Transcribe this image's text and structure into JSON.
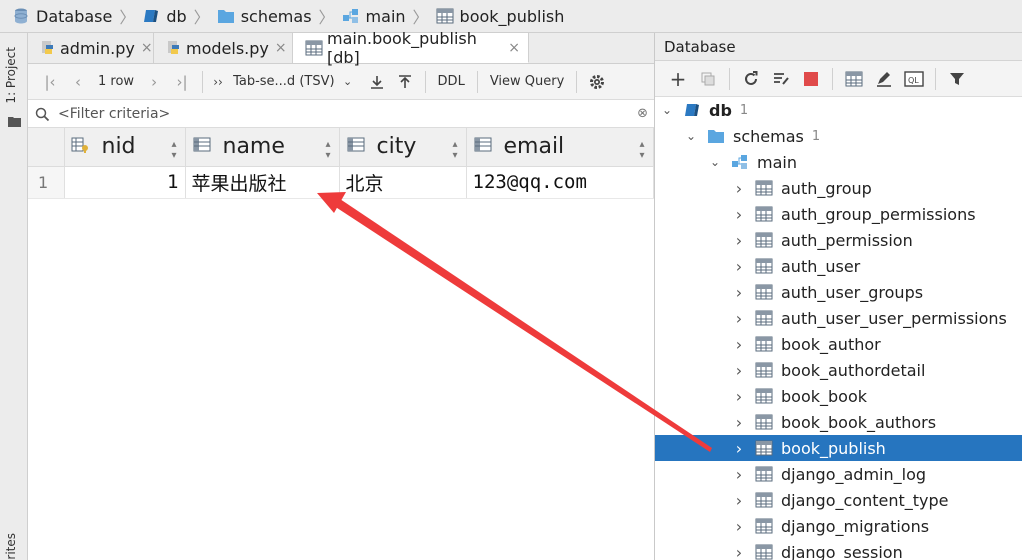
{
  "breadcrumb": {
    "items": [
      "Database",
      "db",
      "schemas",
      "main",
      "book_publish"
    ]
  },
  "left_strip": {
    "project_label": "1: Project",
    "favorites_label": "rites"
  },
  "editor": {
    "tabs": [
      {
        "label": "admin.py",
        "close": "×"
      },
      {
        "label": "models.py",
        "close": "×"
      },
      {
        "label": "main.book_publish [db]",
        "close": "×",
        "active": true
      }
    ],
    "toolbar": {
      "row_count": "1 row",
      "format": "Tab-se...d (TSV)",
      "ddl": "DDL",
      "view_query": "View Query"
    },
    "filter": {
      "placeholder": "<Filter criteria>",
      "clear": "⊗"
    },
    "grid": {
      "columns": [
        "nid",
        "name",
        "city",
        "email"
      ],
      "rows": [
        {
          "num": "1",
          "nid": "1",
          "name": "苹果出版社",
          "city": "北京",
          "email": "123@qq.com"
        }
      ]
    }
  },
  "db_panel": {
    "title": "Database",
    "tree": {
      "db": {
        "label": "db",
        "count": "1"
      },
      "schemas": {
        "label": "schemas",
        "count": "1"
      },
      "main": {
        "label": "main"
      },
      "tables": [
        "auth_group",
        "auth_group_permissions",
        "auth_permission",
        "auth_user",
        "auth_user_groups",
        "auth_user_user_permissions",
        "book_author",
        "book_authordetail",
        "book_book",
        "book_book_authors",
        "book_publish",
        "django_admin_log",
        "django_content_type",
        "django_migrations",
        "django_session"
      ],
      "selected": "book_publish"
    }
  },
  "colors": {
    "selection": "#2675bf",
    "arrow": "#ee3b3b",
    "table_icon": "#5a6b7d",
    "folder": "#5aa6e0"
  }
}
